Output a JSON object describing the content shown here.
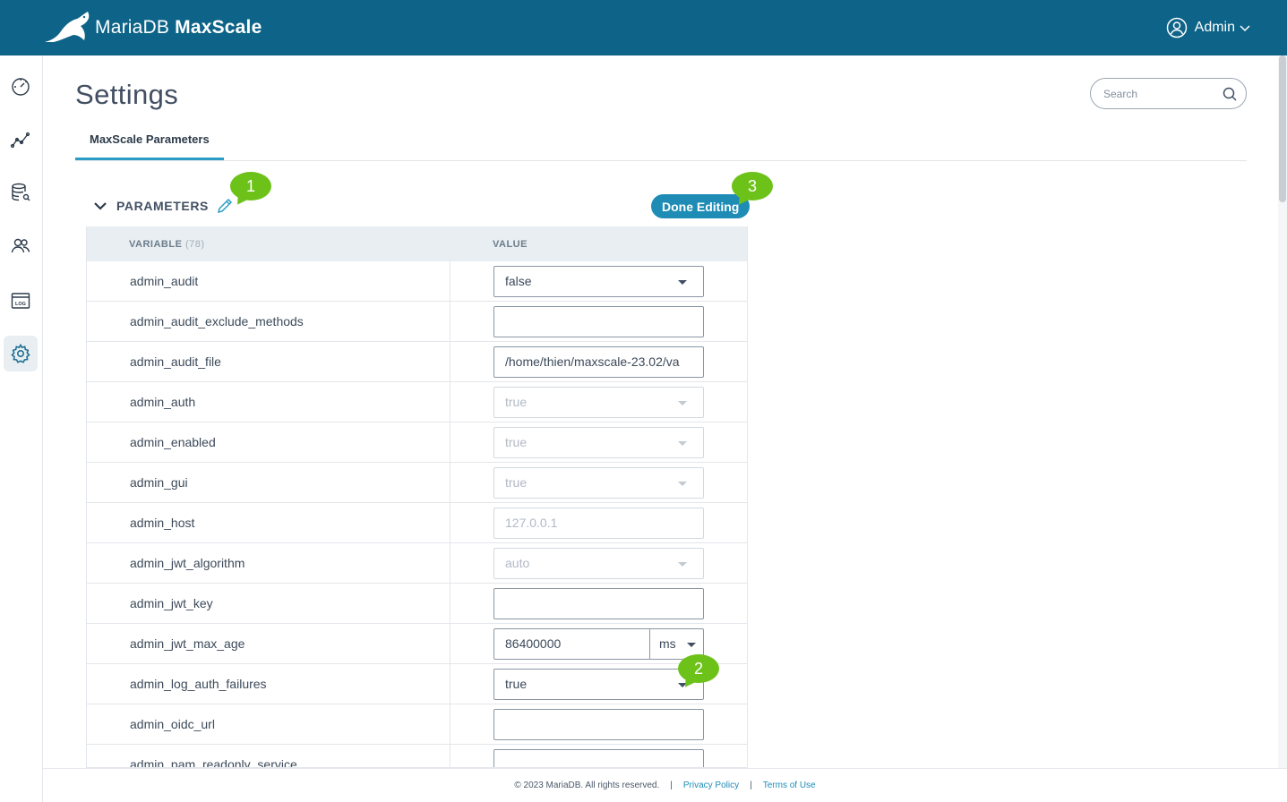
{
  "header": {
    "brand_main": "MariaDB",
    "brand_sub": "MaxScale",
    "user_label": "Admin"
  },
  "sidebar": {
    "items": [
      {
        "icon": "dashboard-icon"
      },
      {
        "icon": "visualization-icon"
      },
      {
        "icon": "query-editor-icon"
      },
      {
        "icon": "users-icon"
      },
      {
        "icon": "logs-icon"
      },
      {
        "icon": "settings-icon",
        "active": true
      }
    ]
  },
  "page": {
    "title": "Settings",
    "search_placeholder": "Search",
    "tab": "MaxScale Parameters"
  },
  "section": {
    "title": "PARAMETERS",
    "done_button": "Done Editing"
  },
  "table": {
    "col_variable": "VARIABLE",
    "col_count": "(78)",
    "col_value": "VALUE",
    "rows": [
      {
        "name": "admin_audit",
        "type": "select",
        "value": "false",
        "disabled": false
      },
      {
        "name": "admin_audit_exclude_methods",
        "type": "input",
        "value": "",
        "disabled": false
      },
      {
        "name": "admin_audit_file",
        "type": "input",
        "value": "/home/thien/maxscale-23.02/va",
        "disabled": false
      },
      {
        "name": "admin_auth",
        "type": "select",
        "value": "true",
        "disabled": true
      },
      {
        "name": "admin_enabled",
        "type": "select",
        "value": "true",
        "disabled": true
      },
      {
        "name": "admin_gui",
        "type": "select",
        "value": "true",
        "disabled": true
      },
      {
        "name": "admin_host",
        "type": "input",
        "value": "127.0.0.1",
        "disabled": true
      },
      {
        "name": "admin_jwt_algorithm",
        "type": "select",
        "value": "auto",
        "disabled": true
      },
      {
        "name": "admin_jwt_key",
        "type": "input",
        "value": "",
        "disabled": false
      },
      {
        "name": "admin_jwt_max_age",
        "type": "duration",
        "value": "86400000",
        "unit": "ms",
        "disabled": false
      },
      {
        "name": "admin_log_auth_failures",
        "type": "select",
        "value": "true",
        "disabled": false
      },
      {
        "name": "admin_oidc_url",
        "type": "input",
        "value": "",
        "disabled": false
      },
      {
        "name": "admin_pam_readonly_service",
        "type": "input",
        "value": "",
        "disabled": false
      }
    ]
  },
  "annotations": [
    "1",
    "2",
    "3"
  ],
  "footer": {
    "copyright": "© 2023 MariaDB. All rights reserved.",
    "separator": "|",
    "privacy": "Privacy Policy",
    "terms": "Terms of Use"
  },
  "colors": {
    "topbar": "#0e6488",
    "accent": "#1f8cb5",
    "annotation": "#6dc21a"
  }
}
